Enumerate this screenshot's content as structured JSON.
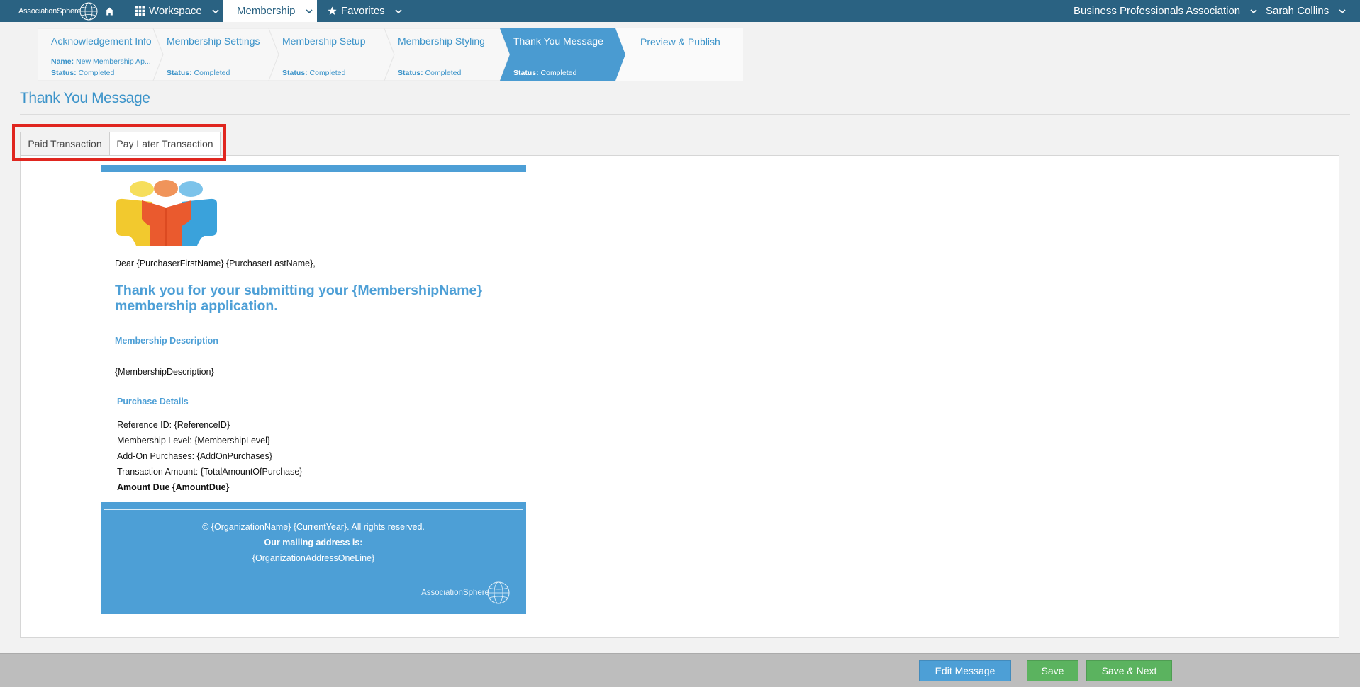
{
  "brand": {
    "logo_text_a": "Association",
    "logo_text_b": "Sphere"
  },
  "nav": {
    "home_icon": "home-icon",
    "workspace_label": "Workspace",
    "membership_label": "Membership",
    "favorites_label": "Favorites",
    "org_label": "Business Professionals Association",
    "user_label": "Sarah Collins"
  },
  "steps": [
    {
      "name": "Acknowledgement Info",
      "meta_key": "Name:",
      "meta_val": "New Membership Ap...",
      "status_key": "Status:",
      "status_val": "Completed"
    },
    {
      "name": "Membership Settings",
      "status_key": "Status:",
      "status_val": "Completed"
    },
    {
      "name": "Membership Setup",
      "status_key": "Status:",
      "status_val": "Completed"
    },
    {
      "name": "Membership Styling",
      "status_key": "Status:",
      "status_val": "Completed"
    },
    {
      "name": "Thank You Message",
      "status_key": "Status:",
      "status_val": "Completed"
    },
    {
      "name": "Preview & Publish"
    }
  ],
  "page": {
    "title": "Thank You Message"
  },
  "tabs": [
    {
      "label": "Paid Transaction"
    },
    {
      "label": "Pay Later Transaction"
    }
  ],
  "email": {
    "greeting": "Dear {PurchaserFirstName} {PurchaserLastName},",
    "headline_line1": "Thank you for your submitting your {MembershipName}",
    "headline_line2": "membership application.",
    "desc_heading": "Membership Description",
    "desc_body": "{MembershipDescription}",
    "purchase_heading": "Purchase Details",
    "reference": "Reference ID: {ReferenceID}",
    "level": "Membership Level: {MembershipLevel}",
    "addons": "Add-On Purchases: {AddOnPurchases}",
    "amount": "Transaction Amount: {TotalAmountOfPurchase}",
    "due": "Amount Due {AmountDue}",
    "footer_copyright": "© {OrganizationName} {CurrentYear}. All rights reserved.",
    "footer_mailing": "Our mailing address is:",
    "footer_address": "{OrganizationAddressOneLine}",
    "footer_brand_a": "Association",
    "footer_brand_b": "Sphere"
  },
  "actions": {
    "edit_label": "Edit Message",
    "save_label": "Save",
    "save_next_label": "Save & Next"
  },
  "colors": {
    "topbar": "#2a6282",
    "accent": "#3b93c9",
    "email_blue": "#4d9fd6",
    "highlight": "#e0261f",
    "success": "#5bb35f"
  }
}
